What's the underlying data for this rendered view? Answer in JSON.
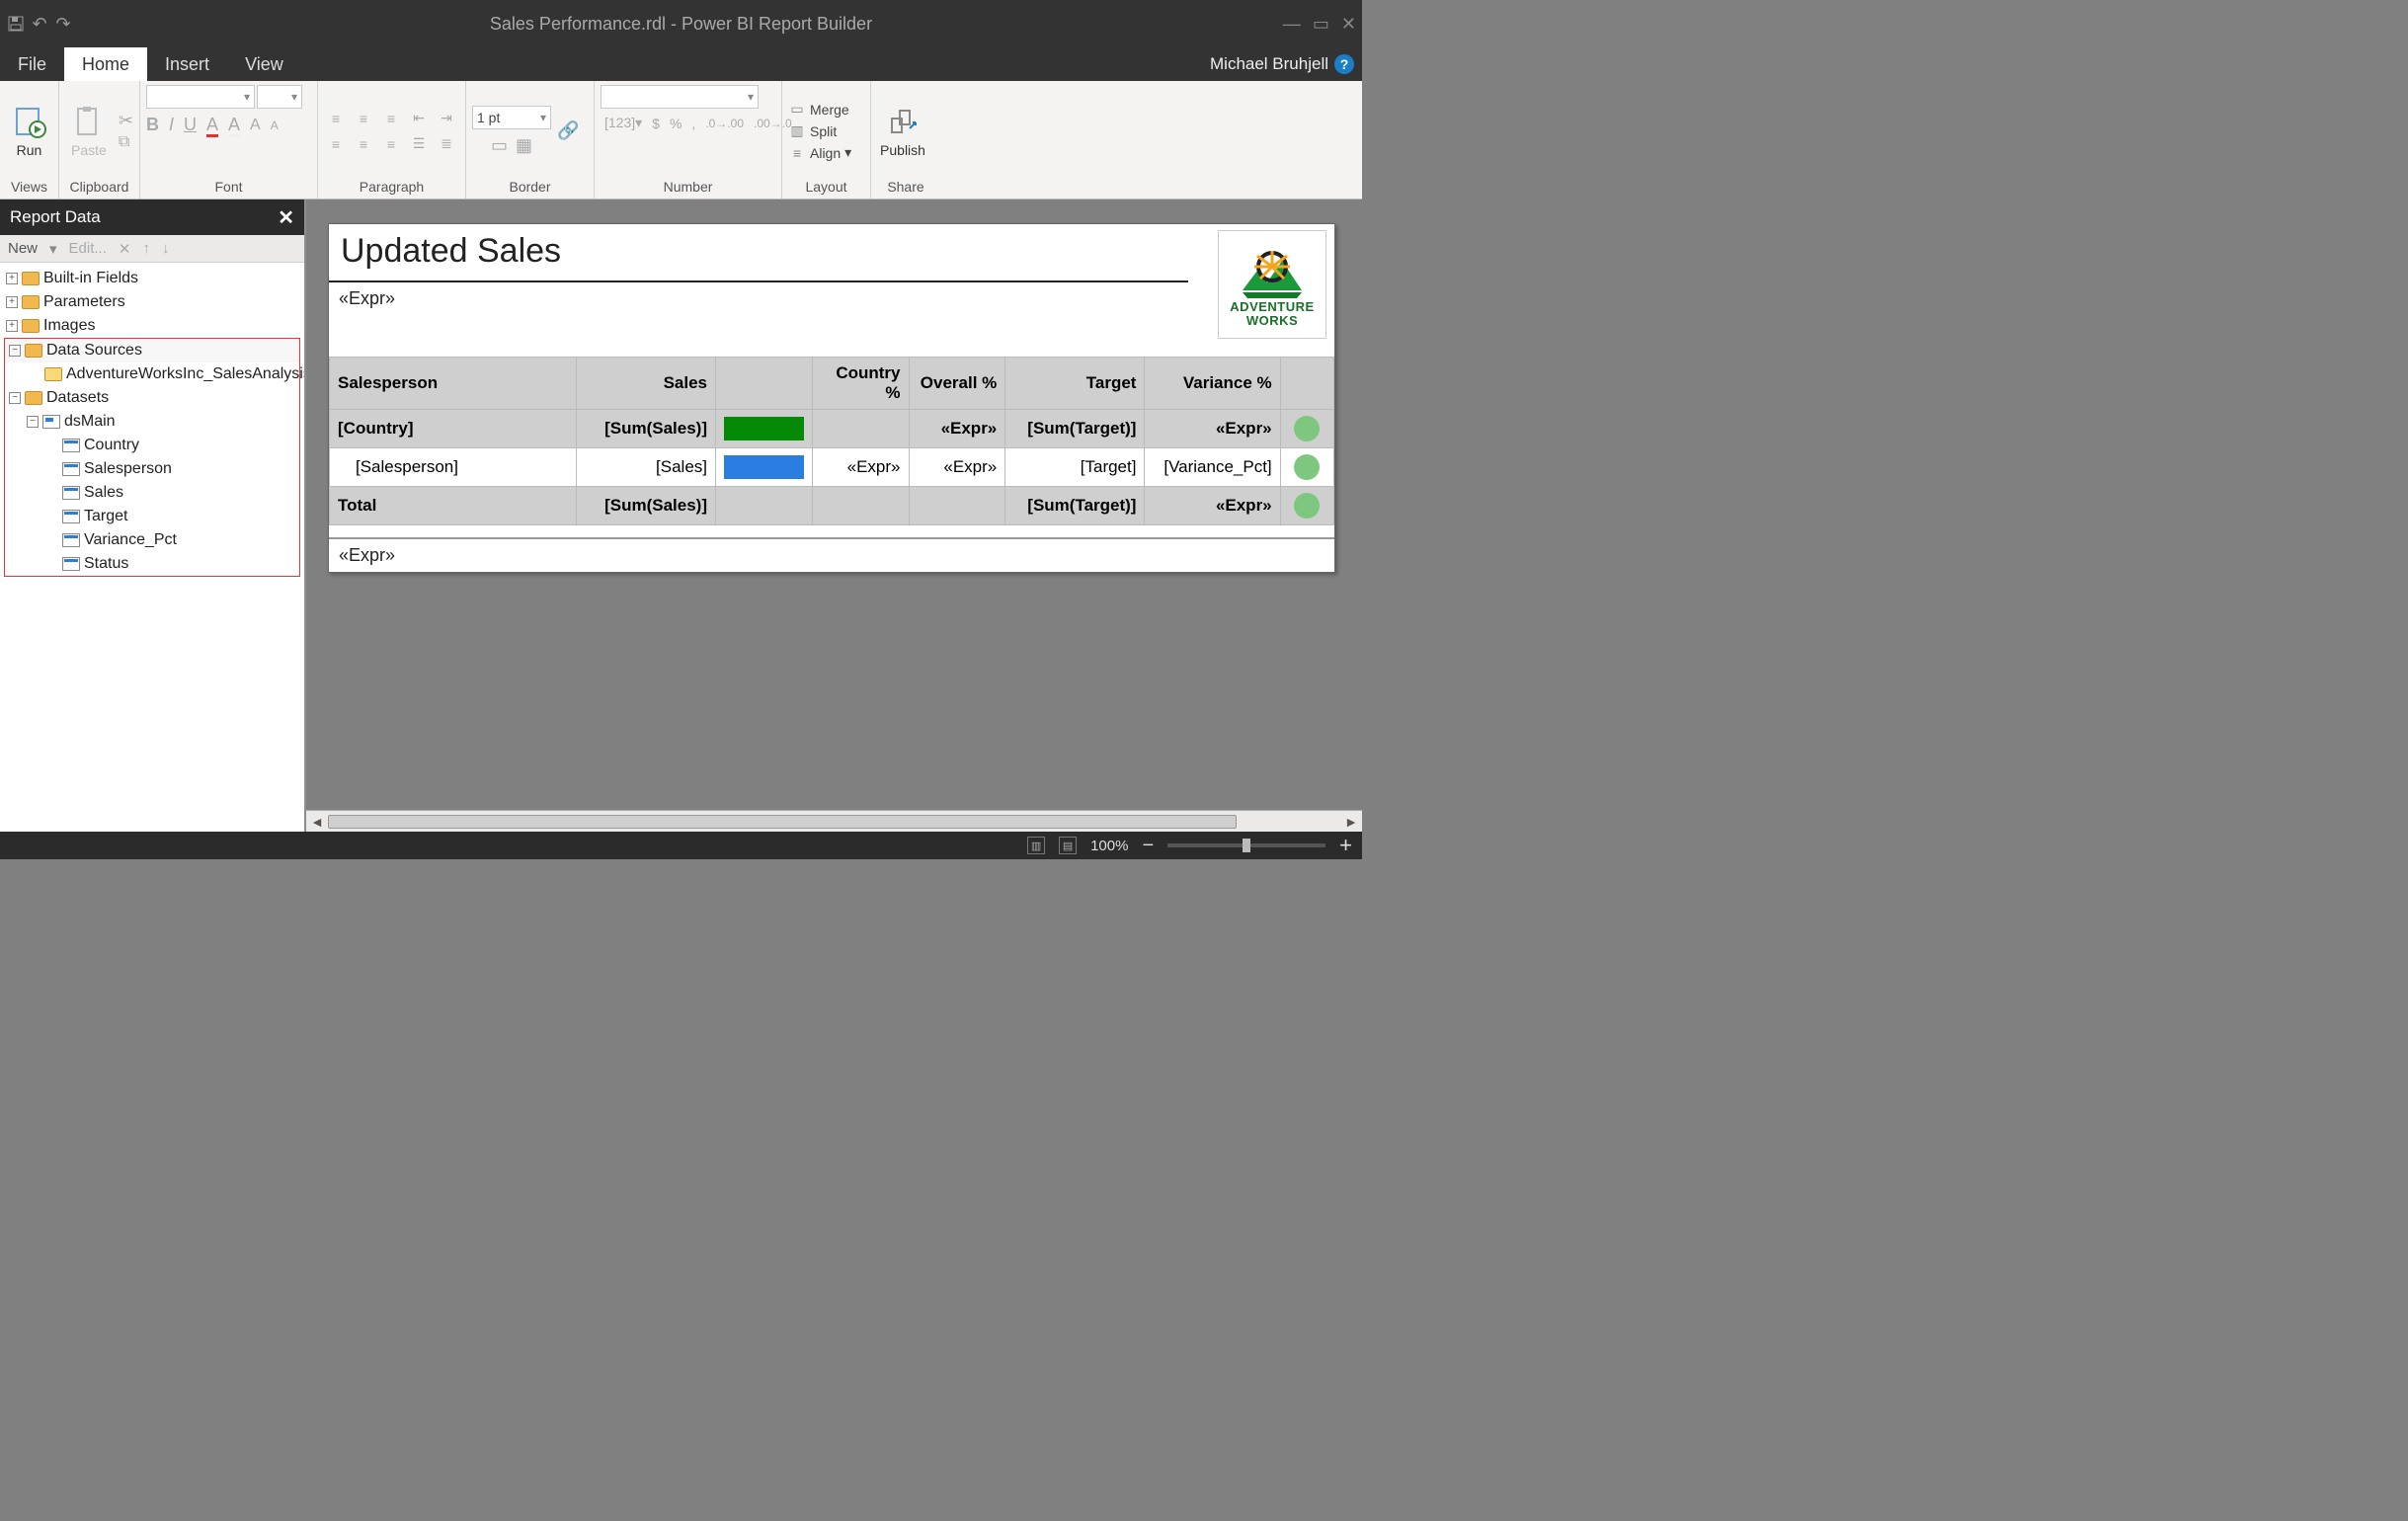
{
  "app": {
    "title": "Sales Performance.rdl - Power BI Report Builder",
    "user": "Michael Bruhjell"
  },
  "menu": {
    "tabs": [
      "File",
      "Home",
      "Insert",
      "View"
    ],
    "active": "Home"
  },
  "ribbon": {
    "groups": {
      "views": "Views",
      "clipboard": "Clipboard",
      "font": "Font",
      "paragraph": "Paragraph",
      "border": "Border",
      "number": "Number",
      "layout": "Layout",
      "share": "Share"
    },
    "run": "Run",
    "paste": "Paste",
    "border_width": "1 pt",
    "layout_items": {
      "merge": "Merge",
      "split": "Split",
      "align": "Align"
    },
    "publish": "Publish"
  },
  "reportdata": {
    "title": "Report Data",
    "toolbar": {
      "new": "New",
      "edit": "Edit..."
    },
    "tree": {
      "builtin": "Built-in Fields",
      "parameters": "Parameters",
      "images": "Images",
      "data_sources": "Data Sources",
      "data_source_items": [
        "AdventureWorksInc_SalesAnalysis"
      ],
      "datasets": "Datasets",
      "dataset_name": "dsMain",
      "fields": [
        "Country",
        "Salesperson",
        "Sales",
        "Target",
        "Variance_Pct",
        "Status"
      ]
    }
  },
  "report": {
    "title": "Updated Sales",
    "header_expr": "«Expr»",
    "footer_expr": "«Expr»",
    "logo": {
      "line1": "ADVENTURE",
      "line2": "WORKS"
    },
    "columns": [
      "Salesperson",
      "Sales",
      "",
      "Country %",
      "Overall %",
      "Target",
      "Variance %",
      ""
    ],
    "group_row": {
      "c0": "[Country]",
      "c1": "[Sum(Sales)]",
      "c4": "«Expr»",
      "c5": "[Sum(Target)]",
      "c6": "«Expr»"
    },
    "detail_row": {
      "c0": "[Salesperson]",
      "c1": "[Sales]",
      "c3": "«Expr»",
      "c4": "«Expr»",
      "c5": "[Target]",
      "c6": "[Variance_Pct]"
    },
    "total_row": {
      "c0": "Total",
      "c1": "[Sum(Sales)]",
      "c5": "[Sum(Target)]",
      "c6": "«Expr»"
    }
  },
  "status": {
    "zoom": "100%"
  }
}
